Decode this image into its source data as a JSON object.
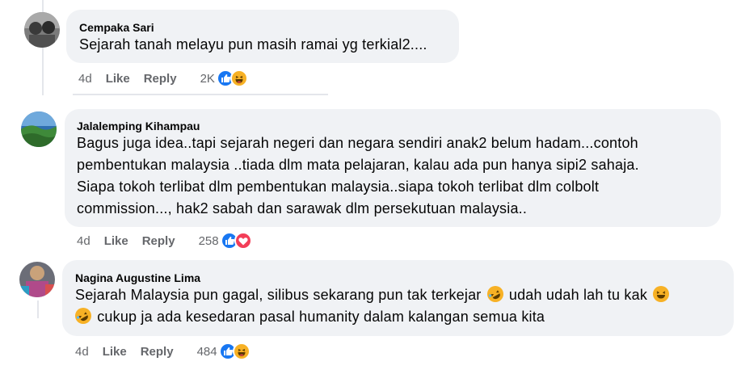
{
  "comments": [
    {
      "author": "Cempaka Sari",
      "lines": [
        "Sejarah tanah melayu pun masih ramai yg terkial2...."
      ],
      "time": "4d",
      "like_label": "Like",
      "reply_label": "Reply",
      "reaction_count": "2K",
      "reactions": [
        "like-icon",
        "haha-icon"
      ]
    },
    {
      "author": "Jalalemping Kihampau",
      "lines": [
        "Bagus juga idea..tapi sejarah negeri dan negara sendiri anak2 belum hadam...contoh",
        "pembentukan malaysia ..tiada dlm mata pelajaran, kalau ada pun hanya sipi2 sahaja.",
        "Siapa tokoh terlibat dlm pembentukan malaysia..siapa tokoh terlibat dlm colbolt",
        "commission..., hak2 sabah dan sarawak dlm persekutuan malaysia.."
      ],
      "time": "4d",
      "like_label": "Like",
      "reply_label": "Reply",
      "reaction_count": "258",
      "reactions": [
        "like-icon",
        "love-icon"
      ]
    },
    {
      "author": "Nagina Augustine Lima",
      "line1_a": "Sejarah Malaysia pun gagal, silibus sekarang pun tak terkejar",
      "line1_b": "udah udah lah tu kak",
      "line2": "cukup ja ada kesedaran pasal humanity dalam kalangan semua kita",
      "time": "4d",
      "like_label": "Like",
      "reply_label": "Reply",
      "reaction_count": "484",
      "reactions": [
        "like-icon",
        "haha-icon"
      ]
    }
  ],
  "colors": {
    "bubble": "#f0f2f5",
    "meta_text": "#65676b",
    "like_blue": "#1877f2",
    "haha_yellow": "#f7b125",
    "love_red": "#f33e58"
  }
}
